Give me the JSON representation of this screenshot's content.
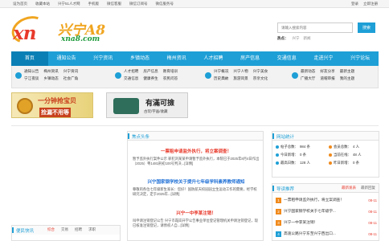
{
  "topbar": {
    "left": [
      "设为首页",
      "收藏本站",
      "兴宁51人才网",
      "手机版",
      "微信客服",
      "微信订阅号",
      "微信服务号"
    ],
    "right": [
      "登录",
      "立即注册"
    ]
  },
  "logo": {
    "letters": "xn",
    "name": "兴宁A8",
    "domain": "xna8.com"
  },
  "search": {
    "placeholder": "请输入搜索内容",
    "button": "搜索"
  },
  "hot": {
    "label": "热点：",
    "items": [
      "兴宁",
      "新闻"
    ]
  },
  "nav": {
    "items": [
      "首页",
      "通知公告",
      "兴宁资讯",
      "乡镇动态",
      "梅州资讯",
      "人才招聘",
      "房产信息",
      "交通信息",
      "走进兴宁",
      "兴宁论坛"
    ],
    "active_index": 0
  },
  "subnav": {
    "groups": [
      {
        "links": [
          "通知公告",
          "梅州资讯",
          "兴宁资讯",
          "宁江夜谈",
          "乡镇动态",
          "社会广角"
        ]
      },
      {
        "links": [
          "人才招聘",
          "房产信息",
          "教育培训",
          "交通信息",
          "健康养生",
          "农民问答"
        ]
      },
      {
        "links": [
          "兴宁概况",
          "兴宁人物",
          "兴宁美食",
          "历史典故",
          "旅游风景",
          "宗亲文化"
        ]
      },
      {
        "links": [
          "最新动态",
          "好友分享",
          "最新主题",
          "广播大厅",
          "道帽审报",
          "我的主题"
        ]
      }
    ]
  },
  "banners": {
    "b1": {
      "title": "一分钟抢宝贝",
      "sub": "捡漏不用等"
    },
    "b2": {
      "title": "有滿可撿",
      "sub": "古玩/字画/收藏"
    }
  },
  "news": {
    "header": "焦点头条",
    "items": [
      {
        "title": "一票租申请监外执行，将立案调查！",
        "desc": "暂予监外执行案件公示 罪犯刘某某申请暂予监外执行，本院已于2025年8月4日作出（2025）粤1481刑初100号判决...[详情]",
        "blue": false
      },
      {
        "title": "兴宁国家钢学校关于提升七年级学科素养教师通知",
        "desc": "尊敬的各位七年级新生家长：您好！国防航天校园园立生运动工作的需要，经学校研究决定，定于2025年...[详情]",
        "blue": true
      },
      {
        "title": "兴宁一中李某注销！",
        "desc": "叫申请注销登记公告 兴宁市霞岚开学公告事业单位登记管理机关申请注销登记，现已核准注销登记，请债权人自...[详情]",
        "blue": false
      }
    ]
  },
  "stats": {
    "header": "网站统计",
    "cells": [
      {
        "label": "帖子总数：",
        "value": "984 条"
      },
      {
        "label": "会员总数：",
        "value": "4 人"
      },
      {
        "label": "今日新增：",
        "value": "0 条"
      },
      {
        "label": "当前在线：",
        "value": "48 人"
      },
      {
        "label": "最高日数：",
        "value": "128 人"
      },
      {
        "label": "昨日新增：",
        "value": "0 条"
      }
    ]
  },
  "tasks": {
    "header": "导读推荐",
    "tabs": [
      "最新发表",
      "最新回复"
    ],
    "rows": [
      {
        "n": "1",
        "text": "一票租申请监外执行，将立案调查！",
        "date": "08-11"
      },
      {
        "n": "2",
        "text": "兴宁国家钢学校关于七年级学...",
        "date": "08-11"
      },
      {
        "n": "3",
        "text": "兴宁一中李某注销！",
        "date": "08-11"
      },
      {
        "n": "4",
        "text": "高速公路兴宁东至兴宁西出口...",
        "date": "08-11"
      }
    ]
  },
  "flash": {
    "header": "便民快讯",
    "tabs": [
      "综合",
      "交易",
      "招聘",
      "求职"
    ]
  }
}
